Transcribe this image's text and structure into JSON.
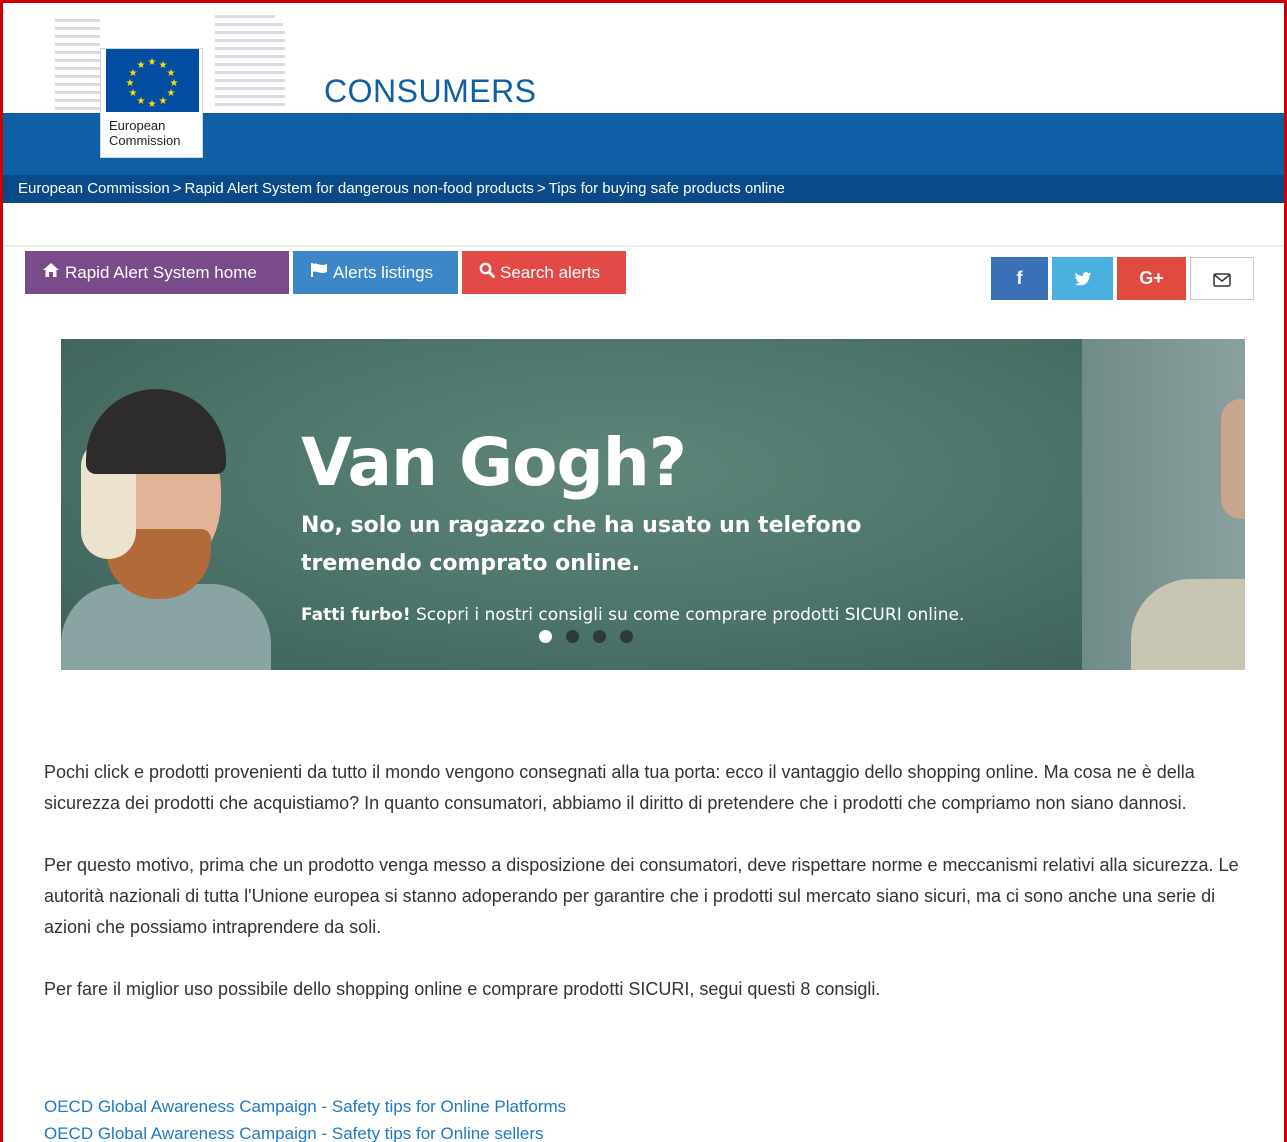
{
  "header": {
    "logo_text_line1": "European",
    "logo_text_line2": "Commission",
    "site_title": "CONSUMERS"
  },
  "breadcrumb": {
    "items": [
      "European Commission",
      "Rapid Alert System for dangerous non-food products",
      "Tips for buying safe products online"
    ],
    "separator": ">"
  },
  "nav": {
    "home_label": "Rapid Alert System home",
    "alerts_label": "Alerts listings",
    "search_label": "Search alerts",
    "home_icon": "home-icon",
    "alerts_icon": "flag-icon",
    "search_icon": "search-icon"
  },
  "share": {
    "facebook": "f",
    "google_plus": "G+",
    "icons": [
      "facebook-icon",
      "twitter-icon",
      "google-plus-icon",
      "envelope-icon"
    ]
  },
  "banner": {
    "title": "Van Gogh?",
    "subtitle": "No, solo un ragazzo che ha usato un telefono tremendo comprato online.",
    "tag_bold": "Fatti furbo!",
    "tag_text": " Scopri i nostri consigli su come comprare prodotti SICURI online.",
    "slides_total": 4,
    "slide_active": 1
  },
  "content": {
    "paragraphs": [
      "Pochi click e prodotti provenienti da tutto il mondo vengono consegnati alla tua porta: ecco il vantaggio dello shopping online. Ma cosa ne è della sicurezza dei prodotti che acquistiamo? In quanto consumatori, abbiamo il diritto di pretendere che i prodotti che compriamo non siano dannosi.",
      "Per questo motivo, prima che un prodotto venga messo a disposizione dei consumatori, deve rispettare norme e meccanismi relativi alla sicurezza. Le autorità nazionali di tutta l'Unione europea si stanno adoperando per garantire che i prodotti sul mercato siano sicuri, ma ci sono anche una serie di azioni che possiamo intraprendere da soli.",
      "Per fare il miglior uso possibile dello shopping online e comprare prodotti SICURI, segui questi 8 consigli."
    ],
    "links": [
      "OECD Global Awareness Campaign - Safety tips for Online Platforms",
      "OECD Global Awareness Campaign - Safety tips for Online sellers"
    ]
  },
  "colors": {
    "brand_blue": "#0f5fa6",
    "breadcrumb_blue": "#0a4a88",
    "home_button": "#7a4b8a",
    "alerts_button": "#3d87c8",
    "search_button": "#e34a47",
    "link": "#1e78c2"
  }
}
